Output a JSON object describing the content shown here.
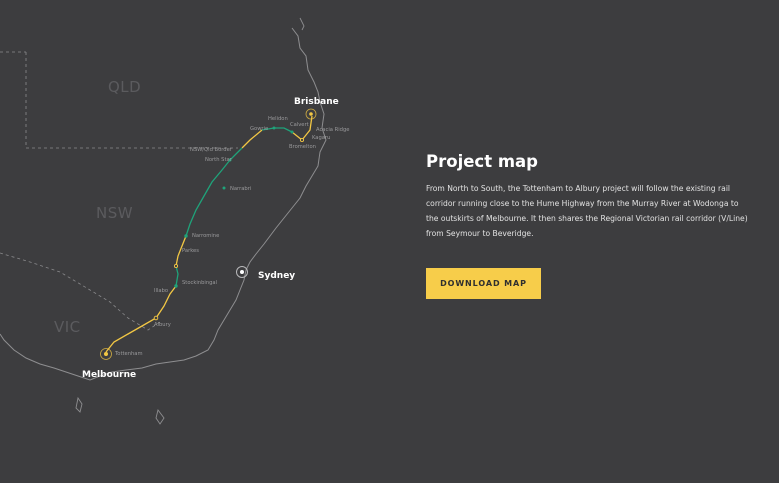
{
  "map": {
    "states": [
      "QLD",
      "NSW",
      "VIC"
    ],
    "cities": {
      "brisbane": "Brisbane",
      "sydney": "Sydney",
      "melbourne": "Melbourne"
    },
    "stations": {
      "helidon": "Helidon",
      "gowrie": "Gowrie",
      "calvert": "Calvert",
      "acacia_ridge": "Acacia Ridge",
      "kagaru": "Kagaru",
      "bromelton": "Bromelton",
      "border": "NSW/Qld Border",
      "north_star": "North Star",
      "narrabri": "Narrabri",
      "narromine": "Narromine",
      "parkes": "Parkes",
      "stockinbingal": "Stockinbingal",
      "illabo": "Illabo",
      "albury": "Albury",
      "tottenham": "Tottenham"
    },
    "colors": {
      "existing_track": "#f2c744",
      "new_track": "#1fa37a",
      "coast": "#8e8e90"
    }
  },
  "panel": {
    "title": "Project map",
    "description": "From North to South, the Tottenham to Albury project will follow the existing rail corridor running close to the Hume Highway from the Murray River at Wodonga to the outskirts of Melbourne. It then shares the Regional Victorian rail corridor (V/Line) from Seymour to Beveridge.",
    "button_label": "DOWNLOAD MAP"
  }
}
